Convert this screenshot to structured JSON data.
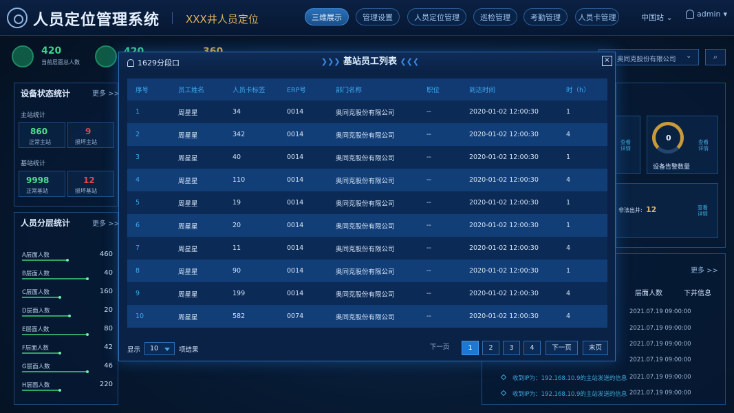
{
  "header": {
    "title": "人员定位管理系统",
    "subtitle": "XXX井人员定位",
    "nav": [
      "三维展示",
      "管理设置",
      "人员定位管理",
      "巡检管理",
      "考勤管理",
      "人员卡管理"
    ],
    "site": "中国站",
    "user": "admin"
  },
  "stats": [
    {
      "value": "420",
      "label": "当前层面总人数"
    },
    {
      "value": "420",
      "label": ""
    },
    {
      "value": "360",
      "label": ""
    }
  ],
  "search": {
    "company": "奥同克股份有限公司"
  },
  "device_panel": {
    "title": "设备状态统计",
    "more": "更多 >>",
    "main_label": "主站统计",
    "main_normal": {
      "value": "860",
      "label": "正常主站"
    },
    "main_broken": {
      "value": "9",
      "label": "损坏主站"
    },
    "base_label": "基站统计",
    "base_normal": {
      "value": "9998",
      "label": "正常基站"
    },
    "base_broken": {
      "value": "12",
      "label": "损坏基站"
    }
  },
  "layer_panel": {
    "title": "人员分层统计",
    "more": "更多 >>",
    "rows": [
      {
        "name": "A层面人数",
        "value": "460",
        "fill": 0.5
      },
      {
        "name": "B层面人数",
        "value": "40",
        "fill": 0.72
      },
      {
        "name": "C层面人数",
        "value": "160",
        "fill": 0.42
      },
      {
        "name": "D层面人数",
        "value": "20",
        "fill": 0.52
      },
      {
        "name": "E层面人数",
        "value": "80",
        "fill": 0.72
      },
      {
        "name": "F层面人数",
        "value": "42",
        "fill": 0.42
      },
      {
        "name": "G层面人数",
        "value": "46",
        "fill": 0.72
      },
      {
        "name": "H层面人数",
        "value": "220",
        "fill": 0.42
      }
    ]
  },
  "right_panel": {
    "gauge_value": "0",
    "gauge_label": "设备告警数量",
    "view_detail": "查看详情",
    "illegal_label": "非法出井:",
    "illegal_value": "12",
    "more": "更多 >>",
    "col_layer": "层面人数",
    "col_down": "下井信息",
    "dates": [
      "2021.07.19   09:00:00",
      "2021.07.19   09:00:00",
      "2021.07.19   09:00:00",
      "2021.07.19   09:00:00"
    ],
    "logs": [
      {
        "msg": "收到IP为：192.168.10.9的主站发送的信息",
        "date": "2021.07.19   09:00:00"
      },
      {
        "msg": "收到IP为：192.168.10.9的主站发送的信息",
        "date": "2021.07.19   09:00:00"
      }
    ]
  },
  "modal": {
    "position": "1629分段口",
    "title": "基站员工列表",
    "close": "×",
    "columns": [
      "序号",
      "员工姓名",
      "人员卡标签",
      "ERP号",
      "部门名称",
      "职位",
      "到达时间",
      "时（h）"
    ],
    "rows": [
      [
        "1",
        "周星星",
        "34",
        "0014",
        "奥同克股份有限公司",
        "--",
        "2020-01-02   12:00:30",
        "1"
      ],
      [
        "2",
        "周星星",
        "342",
        "0014",
        "奥同克股份有限公司",
        "--",
        "2020-01-02   12:00:30",
        "4"
      ],
      [
        "3",
        "周星星",
        "40",
        "0014",
        "奥同克股份有限公司",
        "--",
        "2020-01-02   12:00:30",
        "1"
      ],
      [
        "4",
        "周星星",
        "110",
        "0014",
        "奥同克股份有限公司",
        "--",
        "2020-01-02   12:00:30",
        "4"
      ],
      [
        "5",
        "周星星",
        "19",
        "0014",
        "奥同克股份有限公司",
        "--",
        "2020-01-02   12:00:30",
        "1"
      ],
      [
        "6",
        "周星星",
        "20",
        "0014",
        "奥同克股份有限公司",
        "--",
        "2020-01-02   12:00:30",
        "1"
      ],
      [
        "7",
        "周星星",
        "11",
        "0014",
        "奥同克股份有限公司",
        "--",
        "2020-01-02   12:00:30",
        "4"
      ],
      [
        "8",
        "周星星",
        "90",
        "0014",
        "奥同克股份有限公司",
        "--",
        "2020-01-02   12:00:30",
        "1"
      ],
      [
        "9",
        "周星星",
        "199",
        "0014",
        "奥同克股份有限公司",
        "--",
        "2020-01-02   12:00:30",
        "4"
      ],
      [
        "10",
        "周星星",
        "582",
        "0074",
        "奥同克股份有限公司",
        "--",
        "2020-01-02   12:00:30",
        "4"
      ]
    ],
    "pager": {
      "show": "显示",
      "page_size": "10",
      "results": "项结果",
      "prev": "下一页",
      "pages": [
        "1",
        "2",
        "3",
        "4"
      ],
      "next": "下一页",
      "last": "末页"
    }
  }
}
